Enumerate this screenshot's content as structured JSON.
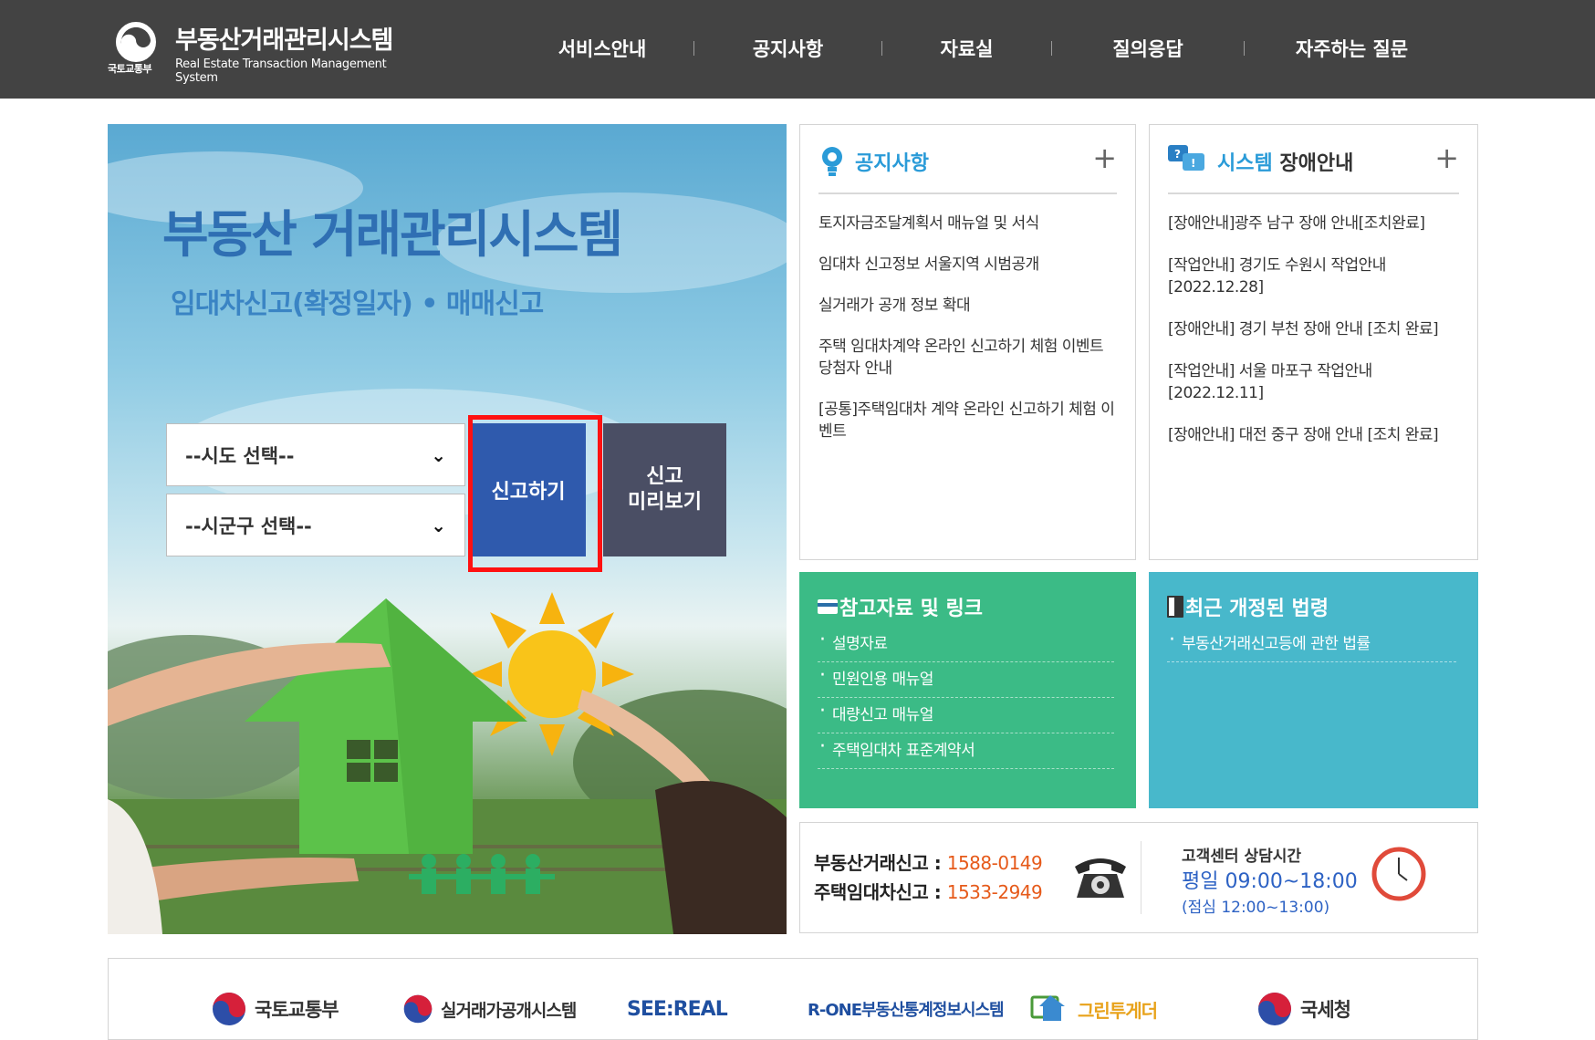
{
  "header": {
    "ministry": "국토교통부",
    "title": "부동산거래관리시스템",
    "subtitle": "Real Estate Transaction Management System",
    "nav": [
      "서비스안내",
      "공지사항",
      "자료실",
      "질의응답",
      "자주하는 질문"
    ]
  },
  "hero": {
    "title": "부동산 거래관리시스템",
    "subtitle": "임대차신고(확정일자) • 매매신고",
    "select_sido": "--시도 선택--",
    "select_sigungu": "--시군구 선택--",
    "report_button": "신고하기",
    "preview_button": "신고\n미리보기"
  },
  "notice": {
    "title": "공지사항",
    "items": [
      "토지자금조달계획서 매뉴얼 및 서식",
      "임대차 신고정보 서울지역 시범공개",
      "실거래가 공개 정보 확대",
      "주택 임대차계약 온라인 신고하기 체험 이벤트 당첨자 안내",
      "[공통]주택임대차 계약 온라인 신고하기 체험 이벤트"
    ]
  },
  "outage": {
    "title_accent": "시스템",
    "title_rest": " 장애안내",
    "items": [
      "[장애안내]광주 남구 장애 안내[조치완료]",
      "[작업안내] 경기도 수원시 작업안내 [2022.12.28]",
      "[장애안내] 경기 부천 장애 안내 [조치 완료]",
      "[작업안내] 서울 마포구 작업안내 [2022.12.11]",
      "[장애안내] 대전 중구 장애 안내 [조치 완료]"
    ]
  },
  "references": {
    "title": "참고자료 및 링크",
    "items": [
      "설명자료",
      "민원인용 매뉴얼",
      "대량신고 매뉴얼",
      "주택임대차 표준계약서"
    ]
  },
  "laws": {
    "title": "최근 개정된 법령",
    "items": [
      "부동산거래신고등에 관한 법률"
    ]
  },
  "contact": {
    "label1": "부동산거래신고 :",
    "number1": "1588-0149",
    "label2": "주택임대차신고 :",
    "number2": "1533-2949",
    "hours_label": "고객센터 상담시간",
    "hours_main": "평일 09:00~18:00",
    "hours_lunch": "(점심 12:00~13:00)"
  },
  "partners": [
    "국토교통부",
    "실거래가공개시스템",
    "SEE:REAL",
    "R-ONE부동산통계정보시스템",
    "그린투게더",
    "국세청"
  ],
  "colors": {
    "header_bg": "#434343",
    "accent_blue": "#2f5aad",
    "notice_title": "#2a9bd8",
    "reference_bg": "#3bbb86",
    "law_bg": "#48b8cb",
    "highlight": "#ff1111",
    "phone_number": "#e65a1a"
  }
}
